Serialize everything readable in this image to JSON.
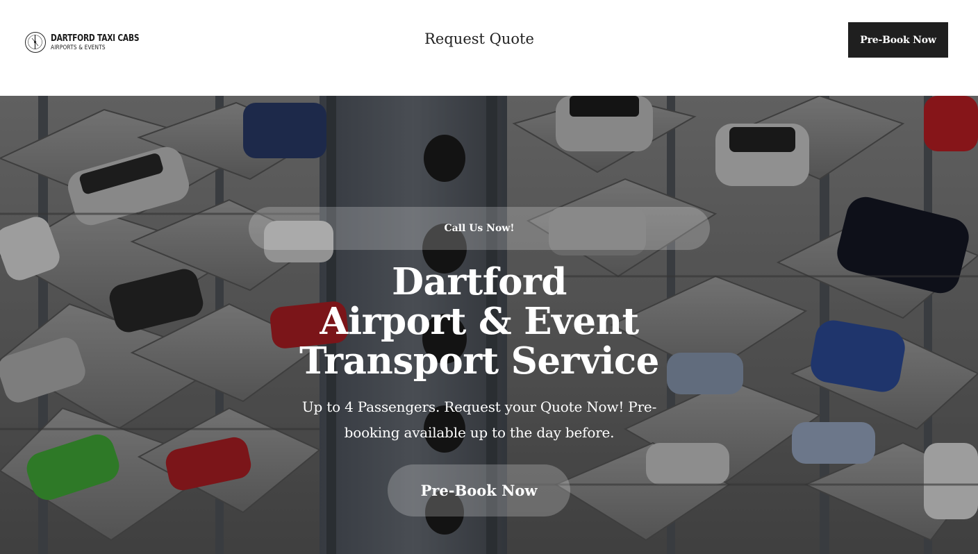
{
  "header": {
    "logo": {
      "name": "DARTFORD TAXI CABS",
      "tagline": "AIRPORTS & EVENTS",
      "icon": "compass-emblem-icon"
    },
    "nav_link": "Request Quote",
    "cta_label": "Pre-Book Now"
  },
  "hero": {
    "background": "multi-storey car tower photo",
    "call_label": "Call Us Now!",
    "title_lines": [
      "Dartford",
      "Airport & Event",
      "Transport Service"
    ],
    "subtitle": "Up to 4 Passengers. Request your Quote Now! Pre-booking available up to the day before.",
    "cta_label": "Pre-Book Now"
  },
  "colors": {
    "header_bg": "#ffffff",
    "button_dark": "#1f1f1f",
    "hero_text": "#ffffff",
    "pill_bg": "rgba(255,255,255,0.22)"
  }
}
